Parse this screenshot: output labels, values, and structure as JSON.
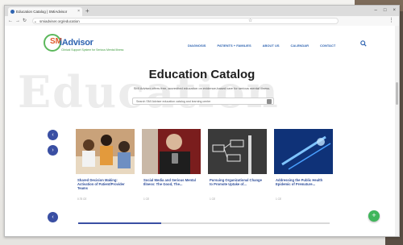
{
  "browser": {
    "tab_title": "Education Catalog | SMiAdvisor",
    "tab_close": "×",
    "new_tab": "+",
    "window_controls": [
      "–",
      "□",
      "×"
    ],
    "url": "smiadviser.org/education",
    "nav_back": "←",
    "nav_forward": "→",
    "nav_reload": "↻",
    "bookmark_icon": "☆",
    "menu_icon": "⋮"
  },
  "site": {
    "logo_sm": "SM",
    "logo_name": "iAdvisor",
    "logo_tagline": "Clinical Support System for Serious Mental Illness",
    "nav": [
      "DIAGNOSIS",
      "PATIENTS + FAMILIES",
      "ABOUT US",
      "CALENDAR",
      "CONTACT"
    ]
  },
  "page": {
    "watermark": "Education",
    "title": "Education Catalog",
    "subtitle": "SMI Adviser offers free, accredited education on evidence-based care for serious mental illness.",
    "search_placeholder": "Search SMI Adviser education catalog and learning center",
    "arrow_up": "‹",
    "arrow_down": "›",
    "arrow_bottom": "‹",
    "fab": "+",
    "carousel_progress": 0.33
  },
  "cards": [
    {
      "title": "Shared Decision Making: Activation of Patient/Provider Teams",
      "meta": "0.75 CE"
    },
    {
      "title": "Social Media and Serious Mental Illness: The Good, The...",
      "meta": "1 CE"
    },
    {
      "title": "Pursuing Organizational Change to Promote Uptake of...",
      "meta": "1 CE"
    },
    {
      "title": "Addressing the Public Health Epidemic of Premature...",
      "meta": "1 CE"
    }
  ],
  "colors": {
    "brand_blue": "#2f64b1",
    "accent_navy": "#3a4fa3",
    "brand_green": "#3fb65a",
    "logo_orange": "#e05a2a"
  }
}
